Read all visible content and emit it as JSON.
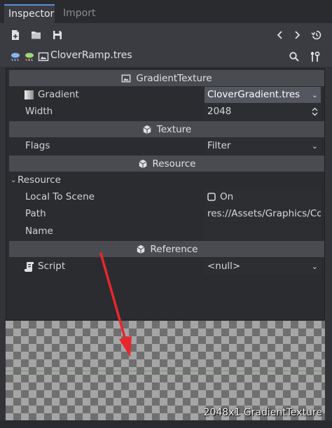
{
  "tabs": {
    "inspector": "Inspector",
    "import": "Import"
  },
  "path_bar": {
    "resource_name": "CloverRamp.tres"
  },
  "sections": {
    "gradient_texture": "GradientTexture",
    "texture": "Texture",
    "resource_section": "Resource",
    "reference": "Reference"
  },
  "category": {
    "resource": "Resource"
  },
  "properties": {
    "gradient": {
      "label": "Gradient",
      "value": "CloverGradient.tres"
    },
    "width": {
      "label": "Width",
      "value": "2048"
    },
    "flags": {
      "label": "Flags",
      "value": "Filter"
    },
    "local_to_scene": {
      "label": "Local To Scene",
      "value": "On"
    },
    "path": {
      "label": "Path",
      "value": "res://Assets/Graphics/Colo"
    },
    "name": {
      "label": "Name",
      "value": ""
    },
    "script": {
      "label": "Script",
      "value": "<null>"
    }
  },
  "preview": {
    "caption": "2048x1 GradientTexture"
  },
  "colors": {
    "accent": "#5b8fd6",
    "annotation_arrow": "#e8262c"
  }
}
